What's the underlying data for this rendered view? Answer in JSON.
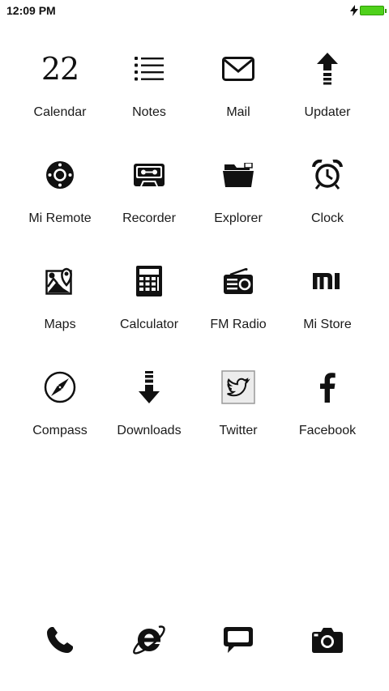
{
  "status_bar": {
    "time": "12:09 PM",
    "icons": [
      "charging-bolt-icon",
      "battery-icon"
    ],
    "battery_color": "#4fd11b"
  },
  "apps": [
    {
      "label": "Calendar",
      "icon": "calendar-icon",
      "number": "22"
    },
    {
      "label": "Notes",
      "icon": "notes-list-icon"
    },
    {
      "label": "Mail",
      "icon": "mail-envelope-icon"
    },
    {
      "label": "Updater",
      "icon": "updater-arrow-icon"
    },
    {
      "label": "Mi Remote",
      "icon": "remote-dpad-icon"
    },
    {
      "label": "Recorder",
      "icon": "cassette-tape-icon"
    },
    {
      "label": "Explorer",
      "icon": "folder-icon"
    },
    {
      "label": "Clock",
      "icon": "alarm-clock-icon"
    },
    {
      "label": "Maps",
      "icon": "map-pin-icon"
    },
    {
      "label": "Calculator",
      "icon": "calculator-icon"
    },
    {
      "label": "FM Radio",
      "icon": "radio-icon"
    },
    {
      "label": "Mi Store",
      "icon": "mi-logo-icon"
    },
    {
      "label": "Compass",
      "icon": "compass-icon"
    },
    {
      "label": "Downloads",
      "icon": "download-arrow-icon"
    },
    {
      "label": "Twitter",
      "icon": "twitter-bird-icon"
    },
    {
      "label": "Facebook",
      "icon": "facebook-f-icon"
    }
  ],
  "dock": [
    {
      "icon": "phone-icon"
    },
    {
      "icon": "internet-explorer-icon"
    },
    {
      "icon": "message-bubble-icon"
    },
    {
      "icon": "camera-icon"
    }
  ],
  "colors": {
    "icon": "#111111",
    "label": "#1a1a1a",
    "background": "#ffffff"
  }
}
